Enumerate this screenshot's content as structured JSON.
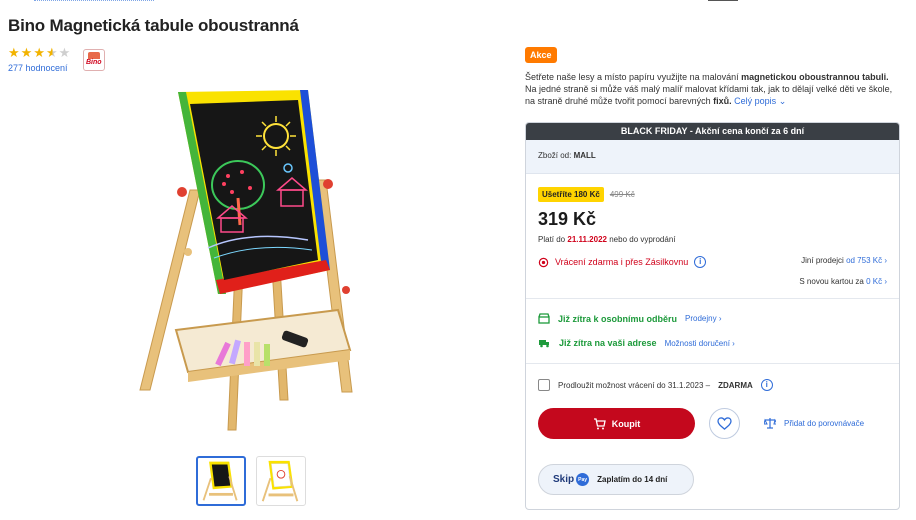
{
  "product": {
    "title": "Bino Magnetická tabule oboustranná",
    "rating_text": "277 hodnocení",
    "rating_stars": 3.5,
    "brand_logo_text": "Bino"
  },
  "right": {
    "badge": "Akce",
    "description_part1": "Šetřete naše lesy a místo papíru využijte na malování ",
    "description_bold1": "magnetickou oboustrannou tabuli.",
    "description_part2": " Na jedné straně si může váš malý malíř malovat křídami tak, jak to dělají velké děti ve škole, na straně druhé může tvořit pomocí barevných ",
    "description_bold2": "fixů.",
    "description_more": "Celý popis"
  },
  "panel": {
    "black_friday": "BLACK FRIDAY - Akční cena končí za 6 dní",
    "seller_label": "Zboží od:",
    "seller_name": "MALL",
    "save_badge": "Ušetříte 180 Kč",
    "old_price": "499 Kč",
    "price": "319 Kč",
    "valid_prefix": "Platí do",
    "valid_date": "21.11.2022",
    "valid_suffix": "nebo do vyprodání",
    "returns": "Vrácení zdarma i přes Zásilkovnu",
    "other_sellers_label": "Jiní prodejci",
    "other_sellers_price": "od 753 Kč",
    "newcard_label": "S novou kartou za",
    "newcard_price": "0 Kč",
    "pickup": "Již zítra k osobnímu odběru",
    "pickup_link": "Prodejny",
    "home": "Již zítra na vaši adrese",
    "home_link": "Možnosti doručení",
    "extend_text": "Prodloužit možnost vrácení do 31.1.2023 –",
    "extend_bold": "ZDARMA",
    "buy": "Koupit",
    "compare": "Přidat do porovnávače",
    "skip_word": "Skip",
    "skip_pay": "Pay",
    "skip_text": "Zaplatím do 14 dní"
  },
  "colors": {
    "accent_red": "#c4081d",
    "link": "#2f6cd8",
    "green": "#1d9a3b",
    "badge_orange": "#ff7a00",
    "save_yellow": "#ffd400"
  }
}
